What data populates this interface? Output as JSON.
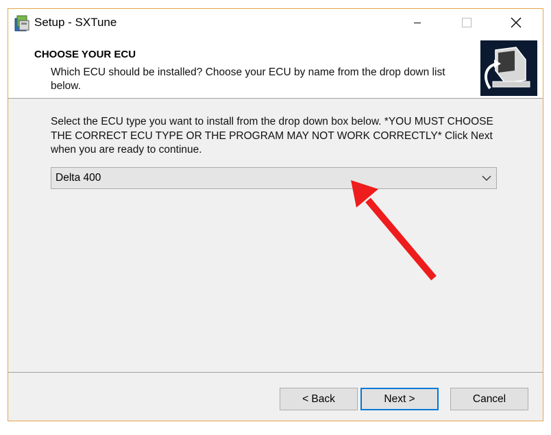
{
  "window": {
    "title": "Setup - SXTune",
    "icon": "setup-installer-icon",
    "controls": [
      "minimize-icon",
      "maximize-icon",
      "close-icon"
    ]
  },
  "header": {
    "title": "CHOOSE YOUR ECU",
    "subtitle": "Which ECU should be installed? Choose your ECU by name from the drop down list below.",
    "image": "computer-install-icon"
  },
  "content": {
    "instructions": "Select the ECU type you want to install from the drop down box below. *YOU MUST CHOOSE THE CORRECT ECU TYPE OR THE PROGRAM MAY NOT WORK CORRECTLY* Click Next when you are ready to continue."
  },
  "ecu_select": {
    "value": "Delta 400"
  },
  "annotation": {
    "type": "red-arrow",
    "color": "#ee1c1c"
  },
  "buttons": {
    "back": "< Back",
    "next": "Next >",
    "cancel": "Cancel"
  },
  "colors": {
    "window_border": "#e3a64a",
    "focus_border": "#0078d7"
  }
}
